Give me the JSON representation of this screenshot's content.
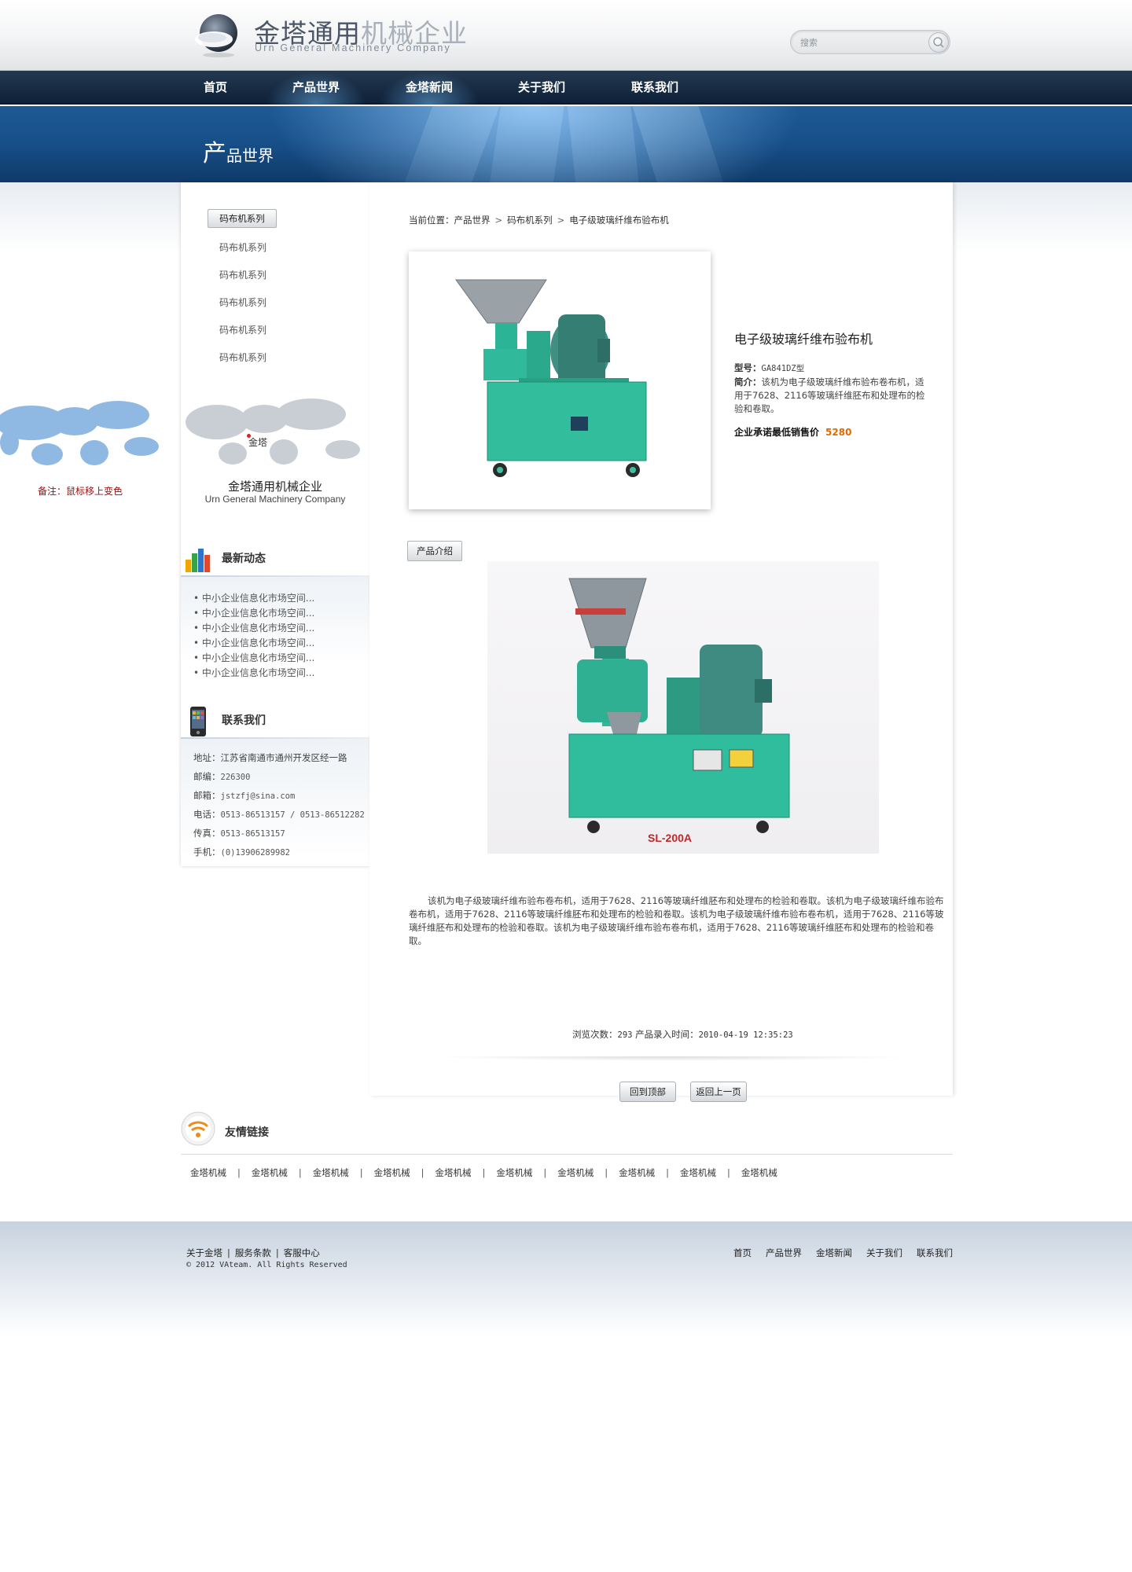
{
  "header": {
    "logo_cn_dark": "金塔通用",
    "logo_cn_light": "机械企业",
    "logo_en": "Urn General Machinery Company",
    "search_placeholder": "搜索"
  },
  "nav": {
    "items": [
      {
        "label": "首页"
      },
      {
        "label": "产品世界"
      },
      {
        "label": "金塔新闻"
      },
      {
        "label": "关于我们"
      },
      {
        "label": "联系我们"
      }
    ]
  },
  "banner": {
    "title_big": "产",
    "title_rest": "品世界"
  },
  "note": {
    "label": "备注：",
    "text": "鼠标移上变色"
  },
  "sidebar": {
    "category_header": "码布机系列",
    "categories": [
      "码布机系列",
      "码布机系列",
      "码布机系列",
      "码布机系列",
      "码布机系列"
    ],
    "map_pin_label": "金塔",
    "company_cn": "金塔通用机械企业",
    "company_en": "Urn General Machinery Company",
    "news_title": "最新动态",
    "news": [
      "• 中小企业信息化市场空间...",
      "• 中小企业信息化市场空间...",
      "• 中小企业信息化市场空间...",
      "• 中小企业信息化市场空间...",
      "• 中小企业信息化市场空间...",
      "• 中小企业信息化市场空间..."
    ],
    "contact_title": "联系我们",
    "contact": [
      {
        "label": "地址：",
        "value": "江苏省南通市通州开发区经一路"
      },
      {
        "label": "邮编：",
        "value": "226300"
      },
      {
        "label": "邮箱：",
        "value": "jstzfj@sina.com"
      },
      {
        "label": "电话：",
        "value": "0513-86513157 / 0513-86512282"
      },
      {
        "label": "传真：",
        "value": "0513-86513157"
      },
      {
        "label": "手机：",
        "value": "(0)13906289982"
      }
    ]
  },
  "main": {
    "breadcrumb": [
      "当前位置：产品世界",
      "码布机系列",
      "电子级玻璃纤维布验布机"
    ],
    "product": {
      "name": "电子级玻璃纤维布验布机",
      "model_label": "型号：",
      "model": "GA841DZ型",
      "brief_label": "简介：",
      "brief": "该机为电子级玻璃纤维布验布卷布机，适用于7628、2116等玻璃纤维胚布和处理布的检验和卷取。",
      "price_label": "企业承诺最低销售价",
      "price": "5280"
    },
    "intro_tab": "产品介绍",
    "intro_photo_label": "SL-200A",
    "intro_text": "该机为电子级玻璃纤维布验布卷布机，适用于7628、2116等玻璃纤维胚布和处理布的检验和卷取。该机为电子级玻璃纤维布验布卷布机，适用于7628、2116等玻璃纤维胚布和处理布的检验和卷取。该机为电子级玻璃纤维布验布卷布机，适用于7628、2116等玻璃纤维胚布和处理布的检验和卷取。该机为电子级玻璃纤维布验布卷布机，适用于7628、2116等玻璃纤维胚布和处理布的检验和卷取。",
    "views_label": "浏览次数：",
    "views": "293",
    "time_label": "产品录入时间：",
    "time": "2010-04-19 12:35:23",
    "btn_top": "回到顶部",
    "btn_back": "返回上一页"
  },
  "links": {
    "title": "友情链接",
    "items": [
      "金塔机械",
      "金塔机械",
      "金塔机械",
      "金塔机械",
      "金塔机械",
      "金塔机械",
      "金塔机械",
      "金塔机械",
      "金塔机械",
      "金塔机械"
    ]
  },
  "footer": {
    "left_links": [
      "关于金塔",
      "服务条款",
      "客服中心"
    ],
    "copyright": "© 2012 VAteam. All Rights Reserved",
    "right_links": [
      "首页",
      "产品世界",
      "金塔新闻",
      "关于我们",
      "联系我们"
    ]
  },
  "colors": {
    "nav_bg": "#162a42",
    "banner_bg": "#18508a",
    "price": "#e06a00",
    "note": "#a01010",
    "machine_green": "#2fb89a"
  }
}
